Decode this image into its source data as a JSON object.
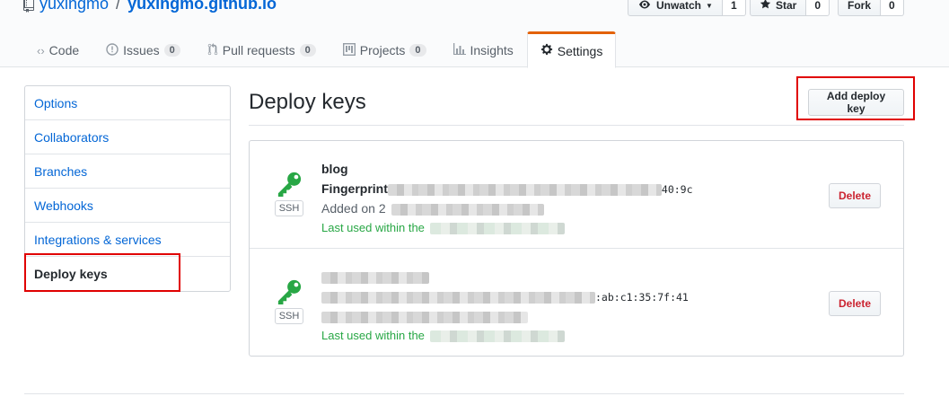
{
  "repo": {
    "owner": "yuxingmo",
    "separator": "/",
    "name": "yuxingmo.github.io"
  },
  "actions": [
    {
      "label": "Unwatch",
      "count": "1",
      "icon": "eye-icon"
    },
    {
      "label": "Star",
      "count": "0",
      "icon": "star-icon"
    },
    {
      "label": "Fork",
      "count": "0",
      "icon": "fork-icon"
    }
  ],
  "tabs": [
    {
      "label": "Code",
      "icon": "code-icon",
      "counter": ""
    },
    {
      "label": "Issues",
      "icon": "issue-icon",
      "counter": "0"
    },
    {
      "label": "Pull requests",
      "icon": "pull-request-icon",
      "counter": "0"
    },
    {
      "label": "Projects",
      "icon": "project-icon",
      "counter": "0"
    },
    {
      "label": "Insights",
      "icon": "graph-icon",
      "counter": ""
    },
    {
      "label": "Settings",
      "icon": "gear-icon",
      "counter": "",
      "selected": true
    }
  ],
  "menu": [
    {
      "label": "Options"
    },
    {
      "label": "Collaborators"
    },
    {
      "label": "Branches"
    },
    {
      "label": "Webhooks"
    },
    {
      "label": "Integrations & services"
    },
    {
      "label": "Deploy keys",
      "active": true
    }
  ],
  "main": {
    "title": "Deploy keys",
    "add_button": "Add deploy key"
  },
  "keys": [
    {
      "title": "blog",
      "fingerprint_label": "Fingerprint",
      "fingerprint_tail": "40:9c",
      "added": "Added on 2",
      "last_used": "Last used within the",
      "type_badge": "SSH",
      "delete_label": "Delete"
    },
    {
      "title": "",
      "fingerprint_label": "",
      "fingerprint_tail": ":ab:c1:35:7f:41",
      "added": "",
      "last_used": "Last used within the",
      "type_badge": "SSH",
      "delete_label": "Delete"
    }
  ],
  "colors": {
    "link": "#0366d6",
    "key_icon": "#28a745",
    "delete_text": "#cb2431",
    "selected_tab_accent": "#e36209",
    "highlight_annotation": "#e00000"
  }
}
